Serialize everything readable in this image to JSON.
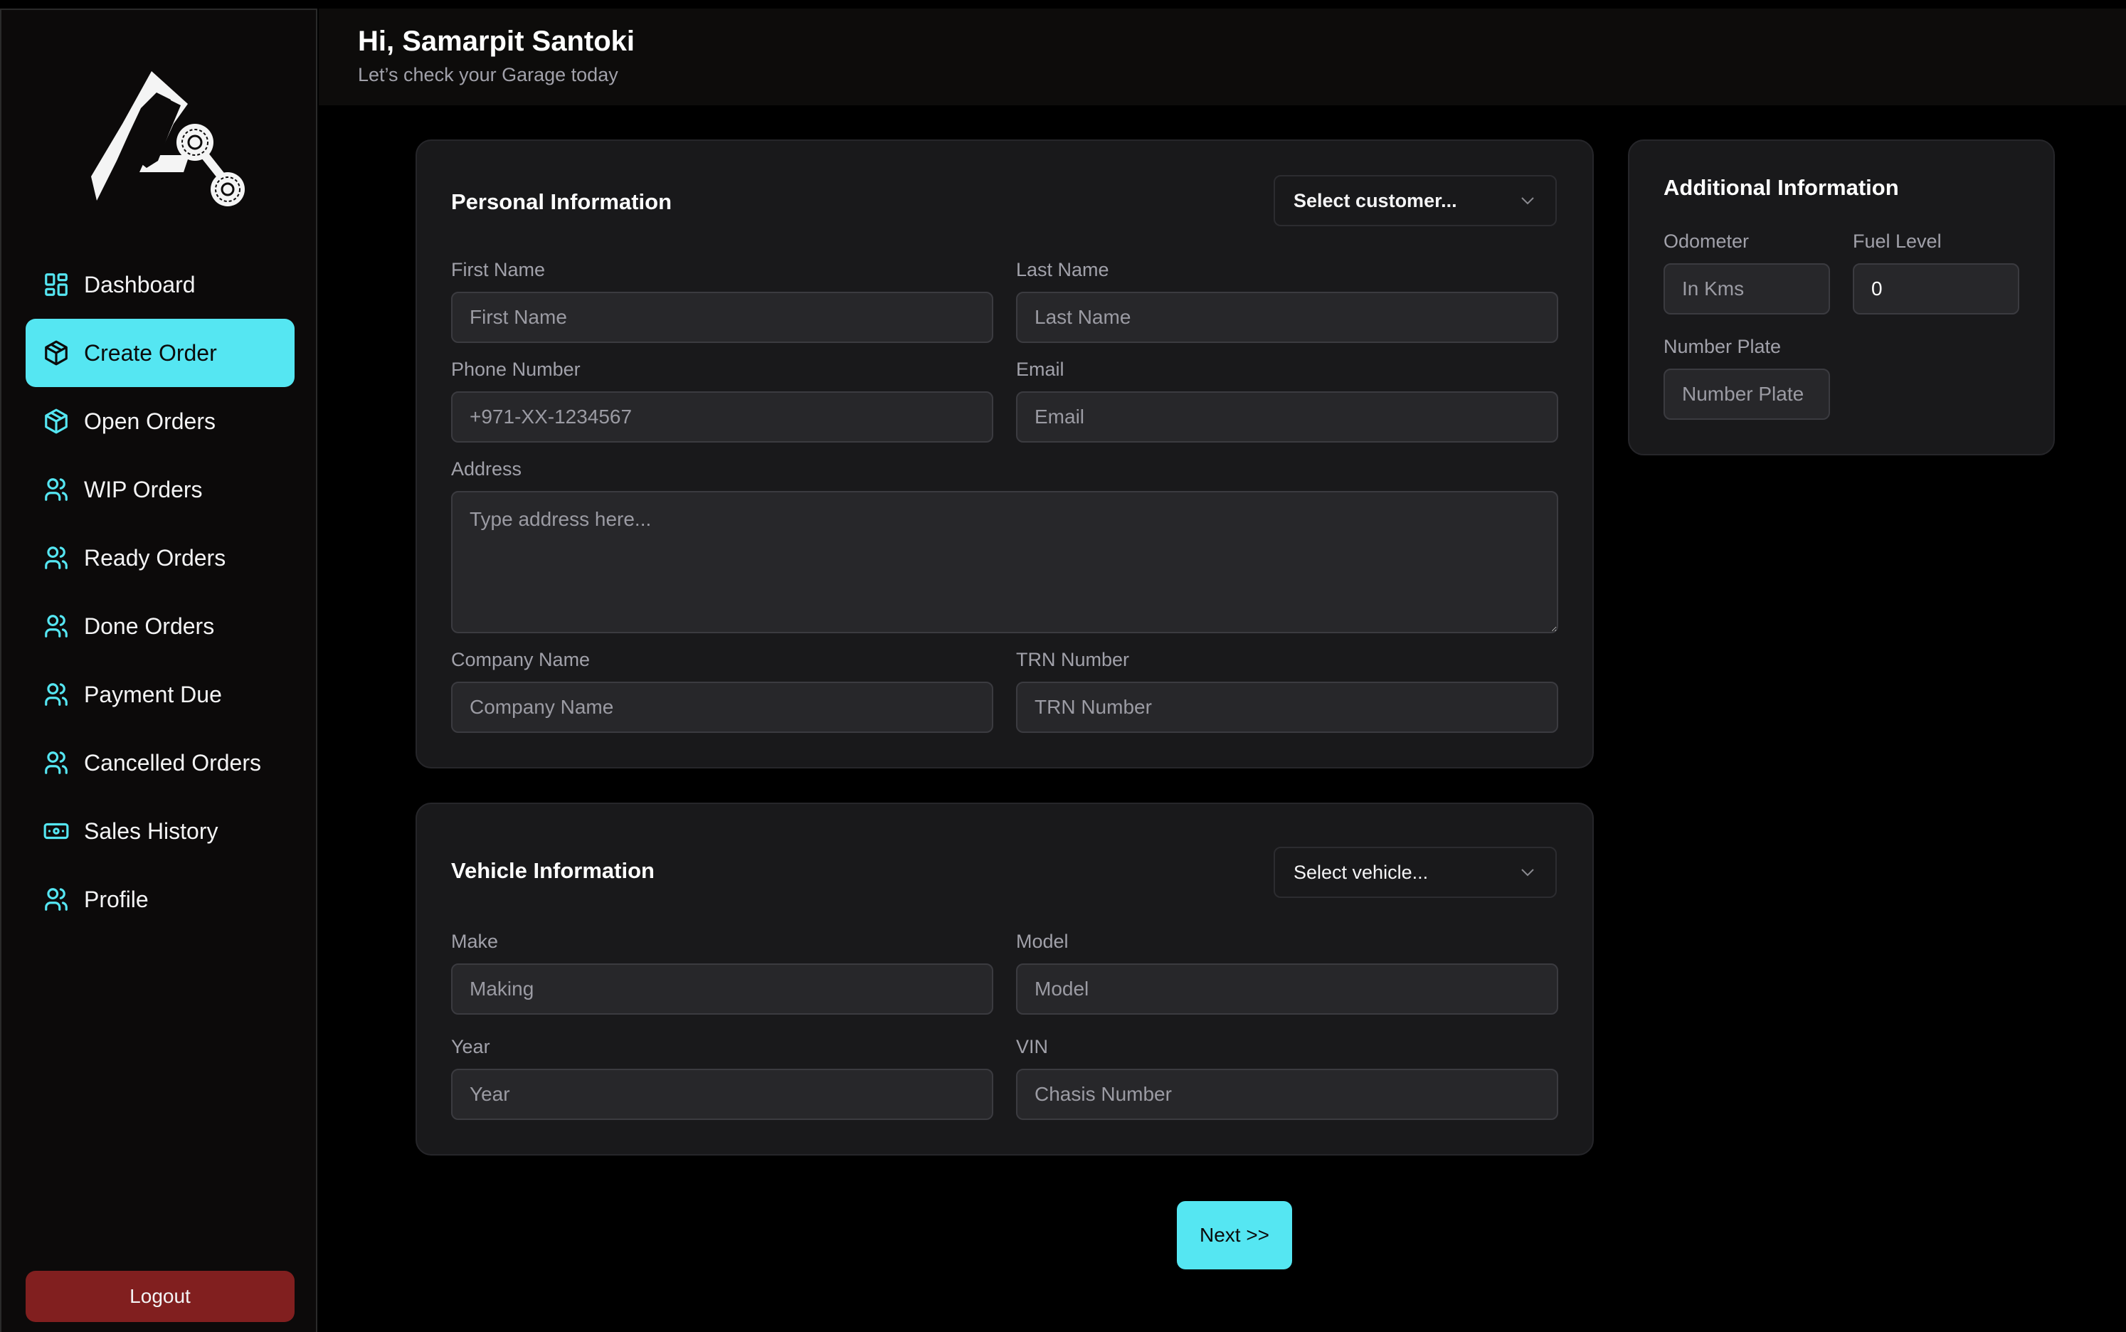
{
  "header": {
    "greeting": "Hi, Samarpit Santoki",
    "subtitle": "Let’s check your Garage today"
  },
  "sidebar": {
    "logo": "garage-logo",
    "items": [
      {
        "label": "Dashboard",
        "icon": "dashboard-grid-icon",
        "active": false
      },
      {
        "label": "Create Order",
        "icon": "package-cube-icon",
        "active": true
      },
      {
        "label": "Open Orders",
        "icon": "package-cube-icon",
        "active": false
      },
      {
        "label": "WIP Orders",
        "icon": "users-icon",
        "active": false
      },
      {
        "label": "Ready Orders",
        "icon": "users-icon",
        "active": false
      },
      {
        "label": "Done Orders",
        "icon": "users-icon",
        "active": false
      },
      {
        "label": "Payment Due",
        "icon": "users-icon",
        "active": false
      },
      {
        "label": "Cancelled Orders",
        "icon": "users-icon",
        "active": false
      },
      {
        "label": "Sales History",
        "icon": "banknote-icon",
        "active": false
      },
      {
        "label": "Profile",
        "icon": "users-icon",
        "active": false
      }
    ],
    "logout_label": "Logout"
  },
  "personal": {
    "title": "Personal Information",
    "select_placeholder": "Select customer...",
    "first_name": {
      "label": "First Name",
      "placeholder": "First Name",
      "value": ""
    },
    "last_name": {
      "label": "Last Name",
      "placeholder": "Last Name",
      "value": ""
    },
    "phone": {
      "label": "Phone Number",
      "placeholder": "+971-XX-1234567",
      "value": ""
    },
    "email": {
      "label": "Email",
      "placeholder": "Email",
      "value": ""
    },
    "address": {
      "label": "Address",
      "placeholder": "Type address here...",
      "value": ""
    },
    "company": {
      "label": "Company Name",
      "placeholder": "Company Name",
      "value": ""
    },
    "trn": {
      "label": "TRN Number",
      "placeholder": "TRN Number",
      "value": ""
    }
  },
  "vehicle": {
    "title": "Vehicle Information",
    "select_placeholder": "Select vehicle...",
    "make": {
      "label": "Make",
      "placeholder": "Making",
      "value": ""
    },
    "model": {
      "label": "Model",
      "placeholder": "Model",
      "value": ""
    },
    "year": {
      "label": "Year",
      "placeholder": "Year",
      "value": ""
    },
    "vin": {
      "label": "VIN",
      "placeholder": "Chasis Number",
      "value": ""
    }
  },
  "additional": {
    "title": "Additional Information",
    "odometer": {
      "label": "Odometer",
      "placeholder": "In Kms",
      "value": ""
    },
    "fuel_level": {
      "label": "Fuel Level",
      "placeholder": "",
      "value": "0"
    },
    "number_plate": {
      "label": "Number Plate",
      "placeholder": "Number Plate",
      "value": ""
    }
  },
  "actions": {
    "next_label": "Next >>"
  },
  "colors": {
    "accent": "#55e6f2",
    "danger": "#811f1f",
    "card": "#19191b",
    "input": "#27272a"
  }
}
